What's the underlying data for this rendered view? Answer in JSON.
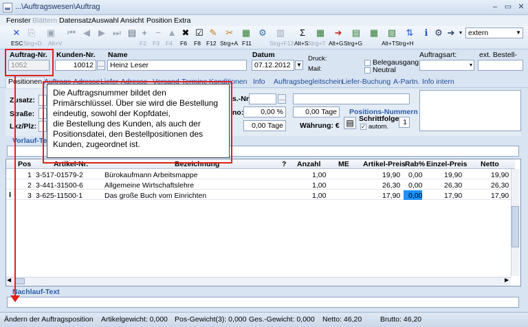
{
  "window": {
    "title": "...\\Auftragswesen\\Auftrag",
    "minimize": "–",
    "restore": "▭",
    "close": "✕"
  },
  "menu": [
    "Fenster",
    "Blättern",
    "Datensatz",
    "Auswahl",
    "Ansicht",
    "Position",
    "Extra"
  ],
  "toolbar": {
    "keys": [
      "ESC",
      "Strg+D",
      "Alt+V",
      "F2",
      "F3",
      "F4",
      "F6",
      "F8",
      "F12",
      "Strg+A",
      "F11",
      "Strg+F12",
      "Alt+S",
      "Strg+T",
      "Alt+G",
      "Strg+G",
      "Alt+T",
      "Strg+H"
    ],
    "dropdown_value": "extern"
  },
  "header": {
    "auftrag_label": "Auftrag-Nr.",
    "auftrag_value": "1052",
    "kunden_label": "Kunden-Nr.",
    "kunden_value": "10012",
    "name_label": "Name",
    "name_value": "Heinz Leser",
    "datum_label": "Datum",
    "datum_value": "07.12.2012",
    "druck_label": "Druck:",
    "mail_label": "Mail:",
    "belegausgang": "Belegausgang",
    "neutral": "Neutral",
    "auftragsart_label": "Auftragsart:",
    "bestell_label": "ext. Bestell-Nr.:"
  },
  "tabs": [
    "Positionen",
    "Auftrags-Adresse",
    "Liefer-Adresse",
    "Versand-Termine",
    "Konditionen",
    "Info",
    "Auftragsbegleitschein",
    "Liefer-Buchung",
    "A-Partn.",
    "Info intern"
  ],
  "panel": {
    "zusatz": "Zusatz:",
    "strasse": "Straße:",
    "lkz": "Lkz/Plz:",
    "s_nr": "s.-Nr.",
    "no": "no:",
    "percent": "0,00 %",
    "tage1": "0,00 Tage",
    "tage2": "0,00 Tage",
    "waehrung": "Währung: €",
    "pos_nummern": "Positions-Nummern",
    "schrittfolge": "Schrittfolge:",
    "schritt_value": "1",
    "autom": "autom."
  },
  "vorlauf_label": "Vorlauf-Text",
  "nachlauf_label": "Nachlauf-Text",
  "grid": {
    "columns": [
      "Pos",
      "Artikel-Nr.",
      "Bezeichnung",
      "?",
      "Anzahl",
      "ME",
      "Artikel-Preis",
      "Rab%",
      "Einzel-Preis",
      "Netto"
    ],
    "rows": [
      [
        "1",
        "3-517-01579-2",
        "Bürokaufmann Arbeitsmappe",
        "",
        "1,00",
        "",
        "19,90",
        "0,00",
        "19,90",
        "19,90"
      ],
      [
        "2",
        "3-441-31500-6",
        "Allgemeine Wirtschaftslehre",
        "",
        "1,00",
        "",
        "26,30",
        "0,00",
        "26,30",
        "26,30"
      ],
      [
        "3",
        "3-625-11500-1",
        "Das große Buch vom Einrichten",
        "",
        "1,00",
        "",
        "17,90",
        "0,00",
        "17,90",
        "17,90"
      ]
    ]
  },
  "callout": "Die Auftragsnummer bildet den Primärschlüssel. Über sie wird die Bestellung eindeutig, die Bestellung des Kunden, sowohl der Kopfdatei, die Bestellung des Kunden, als auch der Positionsdatei, den Bestellpositionen des Kunden, zugeordnet ist.",
  "callout_lines": [
    "Die Auftragsnummer bildet den",
    "Primärschlüssel. Über sie wird die Bestellung",
    "eindeutig, sowohl der Kopfdatei,",
    "die Bestellung des Kunden, als auch der",
    "Positionsdatei, den Bestellpositionen des",
    "Kunden, zugeordnet ist."
  ],
  "status": {
    "text": "Ändern der Auftragsposition",
    "artikelgewicht": "Artikelgewicht: 0,000",
    "posgewicht": "Pos-Gewicht(3): 0,000",
    "gesgewicht": "Ges.-Gewicht: 0,000",
    "netto": "Netto: 46,20",
    "brutto": "Brutto: 46,20"
  },
  "colors": {
    "highlight_red": "#e0201b",
    "selected_cell": "#1e90ff"
  }
}
